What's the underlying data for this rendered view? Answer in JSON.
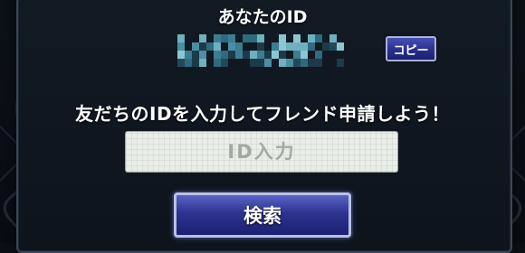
{
  "dialog": {
    "title": "あなたのID",
    "copy_label": "コピー",
    "prompt": "友だちのIDを入力してフレンド申請しよう！",
    "input_placeholder": "ID入力",
    "search_label": "検索"
  },
  "colors": {
    "panel": "#121a24",
    "button_blue": "#2d338f",
    "input_bg": "#e9eee9",
    "blur_tiles": [
      "#1d3a4a",
      "#2f6a7e",
      "#4a8fa3",
      "#6fb0c0",
      "#3d7d90",
      "#24485a",
      "#8cc6d2"
    ]
  }
}
